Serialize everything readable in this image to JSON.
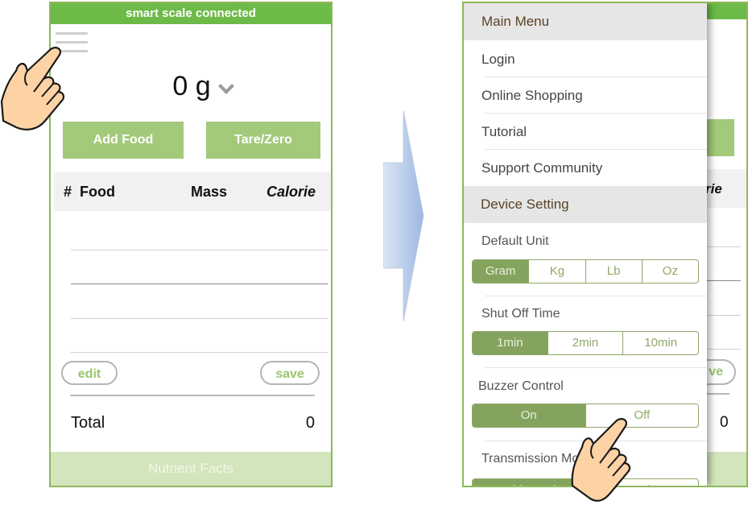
{
  "left_screen": {
    "status_bar": "smart scale connected",
    "weight_value": "0 g",
    "buttons": {
      "add_food": "Add Food",
      "tare_zero": "Tare/Zero",
      "edit": "edit",
      "save": "save"
    },
    "table": {
      "columns": [
        "#",
        "Food",
        "Mass",
        "Calorie"
      ],
      "rows": []
    },
    "total": {
      "label": "Total",
      "value": "0"
    },
    "footer": "Nutrient Facts"
  },
  "right_screen": {
    "background": {
      "calorie_fragment": "rie",
      "save_fragment": "ve",
      "total_value": "0"
    },
    "drawer": {
      "main_menu": {
        "header": "Main Menu",
        "items": [
          "Login",
          "Online Shopping",
          "Tutorial",
          "Support Community"
        ]
      },
      "device_setting": {
        "header": "Device Setting",
        "default_unit": {
          "label": "Default Unit",
          "options": [
            "Gram",
            "Kg",
            "Lb",
            "Oz"
          ],
          "selected": "Gram"
        },
        "shut_off_time": {
          "label": "Shut Off Time",
          "options": [
            "1min",
            "2min",
            "10min"
          ],
          "selected": "1min"
        },
        "buzzer_control": {
          "label": "Buzzer Control",
          "options": [
            "On",
            "Off"
          ],
          "selected": "On"
        },
        "transmission_mode": {
          "label": "Transmission Mo",
          "options": [
            "Stable Mode",
            "Mode"
          ],
          "selected": "Stable Mode"
        }
      }
    }
  },
  "colors": {
    "status_green": "#6dba48",
    "button_green": "#a3c97a",
    "segment_active": "#84a35e",
    "frame": "#8fb85a"
  }
}
